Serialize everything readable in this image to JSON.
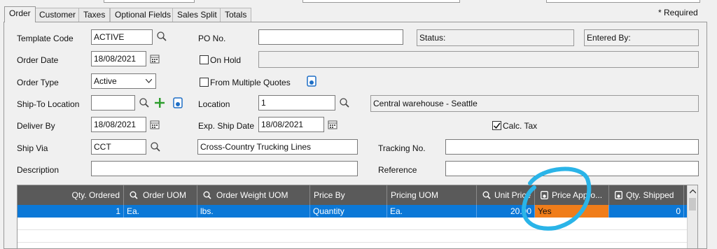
{
  "tabs": [
    {
      "label": "Order",
      "active": true
    },
    {
      "label": "Customer"
    },
    {
      "label": "Taxes"
    },
    {
      "label": "Optional Fields"
    },
    {
      "label": "Sales Split"
    },
    {
      "label": "Totals"
    }
  ],
  "required_note": "* Required",
  "form": {
    "template_code_label": "Template Code",
    "template_code_value": "ACTIVE",
    "po_no_label": "PO No.",
    "po_no_value": "",
    "status_label": "Status:",
    "entered_by_label": "Entered By:",
    "order_date_label": "Order Date",
    "order_date_value": "18/08/2021",
    "on_hold_label": "On Hold",
    "order_type_label": "Order Type",
    "order_type_value": "Active",
    "from_multiple_quotes_label": "From Multiple Quotes",
    "ship_to_location_label": "Ship-To Location",
    "ship_to_location_value": "",
    "location_label": "Location",
    "location_value": "1",
    "location_desc": "Central warehouse - Seattle",
    "deliver_by_label": "Deliver By",
    "deliver_by_value": "18/08/2021",
    "exp_ship_date_label": "Exp. Ship Date",
    "exp_ship_date_value": "18/08/2021",
    "calc_tax_label": "Calc. Tax",
    "ship_via_label": "Ship Via",
    "ship_via_value": "CCT",
    "ship_via_desc": "Cross-Country Trucking Lines",
    "tracking_no_label": "Tracking No.",
    "description_label": "Description",
    "reference_label": "Reference"
  },
  "grid": {
    "columns": [
      "Qty. Ordered",
      "Order UOM",
      "Order Weight UOM",
      "Price By",
      "Pricing UOM",
      "Unit Price",
      "Price Appro...",
      "Qty. Shipped"
    ],
    "row": {
      "qty_ordered": "1",
      "order_uom": "Ea.",
      "order_weight_uom": "lbs.",
      "price_by": "Quantity",
      "pricing_uom": "Ea.",
      "unit_price": "20.00",
      "price_approved": "Yes",
      "qty_shipped": "0"
    }
  },
  "colors": {
    "accent": "#0b78d7",
    "highlight": "#f07d1a",
    "annotation": "#2ab4e8",
    "add_green": "#2f9e2f"
  }
}
